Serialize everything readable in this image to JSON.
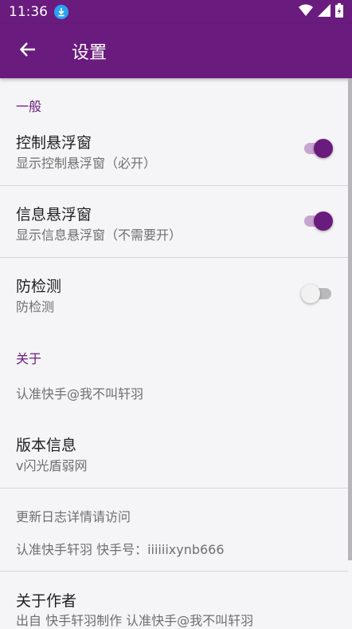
{
  "status": {
    "time": "11:36"
  },
  "appbar": {
    "title": "设置"
  },
  "sections": {
    "general": {
      "header": "一般",
      "items": [
        {
          "title": "控制悬浮窗",
          "subtitle": "显示控制悬浮窗（必开）",
          "checked": true
        },
        {
          "title": "信息悬浮窗",
          "subtitle": "显示信息悬浮窗（不需要开）",
          "checked": true
        },
        {
          "title": "防检测",
          "subtitle": "防检测",
          "checked": false
        }
      ]
    },
    "about": {
      "header": "关于",
      "note1": "认准快手@我不叫轩羽",
      "version_title": "版本信息",
      "version_sub": "v闪光盾弱网",
      "changelog": "更新日志详情请访问",
      "kuaishou": "认准快手轩羽 快手号：iiiiiixynb666",
      "author_title": "关于作者",
      "author_sub": "出自 快手轩羽制作 认准快手@我不叫轩羽"
    }
  },
  "colors": {
    "accent": "#6a1b7e",
    "switch_track_on": "#c6a6d0"
  }
}
